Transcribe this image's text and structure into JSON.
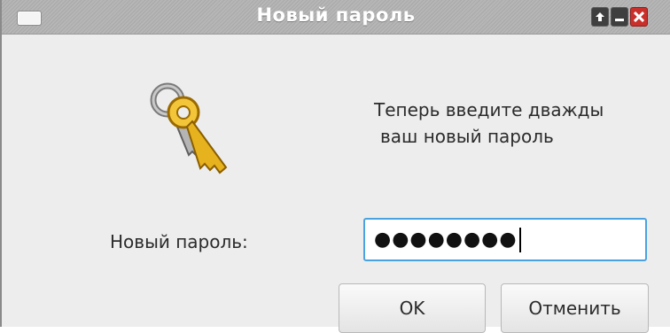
{
  "window": {
    "title": "Новый пароль",
    "controls": {
      "maximize_icon": "arrow-up-icon",
      "minimize_icon": "minimize-icon",
      "close_icon": "close-icon"
    },
    "menu_icon": "window-menu-icon"
  },
  "dialog": {
    "icon": "keys-icon",
    "prompt_line1": "Теперь введите дважды",
    "prompt_line2": "ваш новый пароль",
    "field_label": "Новый пароль:",
    "password_masked": "●●●●●●●●",
    "ok_label": "OK",
    "cancel_label": "Отменить"
  },
  "colors": {
    "close_button": "#c9302c",
    "focus_border": "#4aa3e0",
    "key_gold": "#e6b21e",
    "key_silver": "#9a9a9a"
  }
}
